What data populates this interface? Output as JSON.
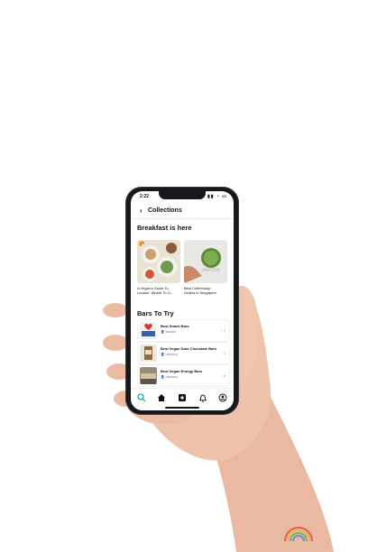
{
  "status_bar": {
    "time": "2:22",
    "indicators": "▮▮ ◔ ▭"
  },
  "header": {
    "back_icon": "chevron-left-icon",
    "title": "Collections"
  },
  "section_breakfast": {
    "title": "Breakfast is here",
    "cards": [
      {
        "caption_1": "A Vegan's Guide To",
        "caption_2": "London: Where To G...",
        "badge": "🥐"
      },
      {
        "caption_1": "Best Coffeeshop",
        "caption_2": "Orders in Singapore"
      }
    ]
  },
  "section_bars": {
    "title": "Bars To Try",
    "items": [
      {
        "title": "Best Snack Bars",
        "author": "Mousie",
        "likes": "1"
      },
      {
        "title": "Best Vegan Dark Chocolate Bars",
        "author": "mihanny",
        "likes": "1"
      },
      {
        "title": "Best Vegan Energy Bars",
        "author": "mihanny",
        "likes": "0"
      }
    ]
  },
  "tabbar": {
    "tabs": [
      {
        "icon": "search-icon",
        "active": true
      },
      {
        "icon": "home-icon",
        "active": false
      },
      {
        "icon": "add-icon",
        "active": false
      },
      {
        "icon": "bell-icon",
        "active": false
      },
      {
        "icon": "profile-icon",
        "active": false
      }
    ],
    "active_color": "#2aa3a8"
  }
}
